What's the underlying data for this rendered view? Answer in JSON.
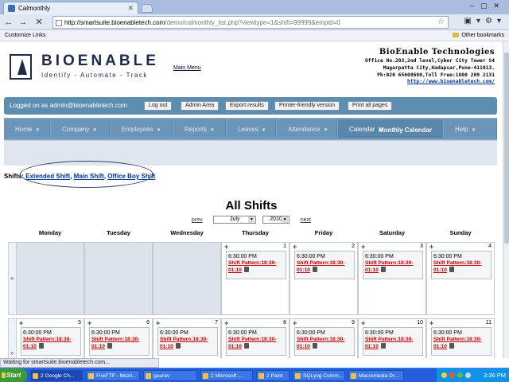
{
  "browser": {
    "tab_title": "Calmonthly",
    "url_host": "http://smartsuite.bioenabletech.com",
    "url_path": "/demo/calmonthly_list.php?viewtype=1&shift=99999&empid=0",
    "bookmark_left": "Customize Links",
    "bookmark_right": "Other bookmarks"
  },
  "header": {
    "brand": "BIOENABLE",
    "tagline": "Identify - Automate - Track",
    "main_menu": "Main Menu",
    "company_name": "BioEnable Technologies",
    "address1": "Office No.203,2nd level,Cyber City Tower S4",
    "address2": "Magarpatta City,Hadapsar,Pune-411013.",
    "phone": "Ph:020 65608600,Toll Free:1800 209 2131",
    "website": "http://www.bioenabletech.com/"
  },
  "topbar": {
    "logged_on": "Logged on as admin@bioenabletech.com",
    "buttons": [
      "Log out",
      "Admin Area",
      "Export results",
      "Printer-friendly version",
      "Print all pages"
    ]
  },
  "menu": {
    "tabs": [
      "Home",
      "Company",
      "Employees",
      "Reports",
      "Leaves",
      "Attendance",
      "Calendar",
      "Help"
    ],
    "active_sub": "Monthly Calendar"
  },
  "shifts": {
    "label": "Shifts",
    "links": [
      "Extended Shift",
      "Main Shift",
      "Office Boy Shift"
    ]
  },
  "calendar": {
    "title": "All Shifts",
    "prev": "prev",
    "next": "next",
    "month": "July",
    "year": "2010",
    "weekmark": "»",
    "days": [
      "Monday",
      "Tuesday",
      "Wednesday",
      "Thursday",
      "Friday",
      "Saturday",
      "Sunday"
    ],
    "entry_time": "6:30:00 PM",
    "entry_pattern_1": "Shift Pattern:18:30-",
    "entry_pattern_2": "01:10",
    "week1": [
      "",
      "",
      "",
      "1",
      "2",
      "3",
      "4"
    ],
    "week2": [
      "5",
      "6",
      "7",
      "8",
      "9",
      "10",
      "11"
    ]
  },
  "statusbar": "Waiting for smartsuite.bioenabletech.com...",
  "taskbar": {
    "start": "Start",
    "tasks": [
      "2 Google Ch...",
      "FireFTP - Mozil...",
      "gaurav",
      "2 Microsoft ...",
      "2 Paint",
      "SQLyog Comm...",
      "Macromedia Dr..."
    ],
    "clock": "3:36 PM"
  }
}
